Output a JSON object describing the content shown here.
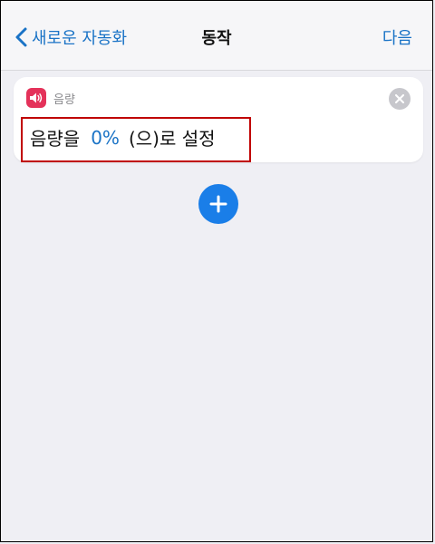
{
  "nav": {
    "back_label": "새로운 자동화",
    "title": "동작",
    "next_label": "다음"
  },
  "action_card": {
    "app_name": "음량",
    "text_before": "음량을",
    "value": "0%",
    "text_after": "(으)로 설정"
  },
  "colors": {
    "accent": "#1a73c6",
    "app_icon": "#e4325a",
    "highlight": "#c00000",
    "add_button": "#1a7ee8"
  }
}
